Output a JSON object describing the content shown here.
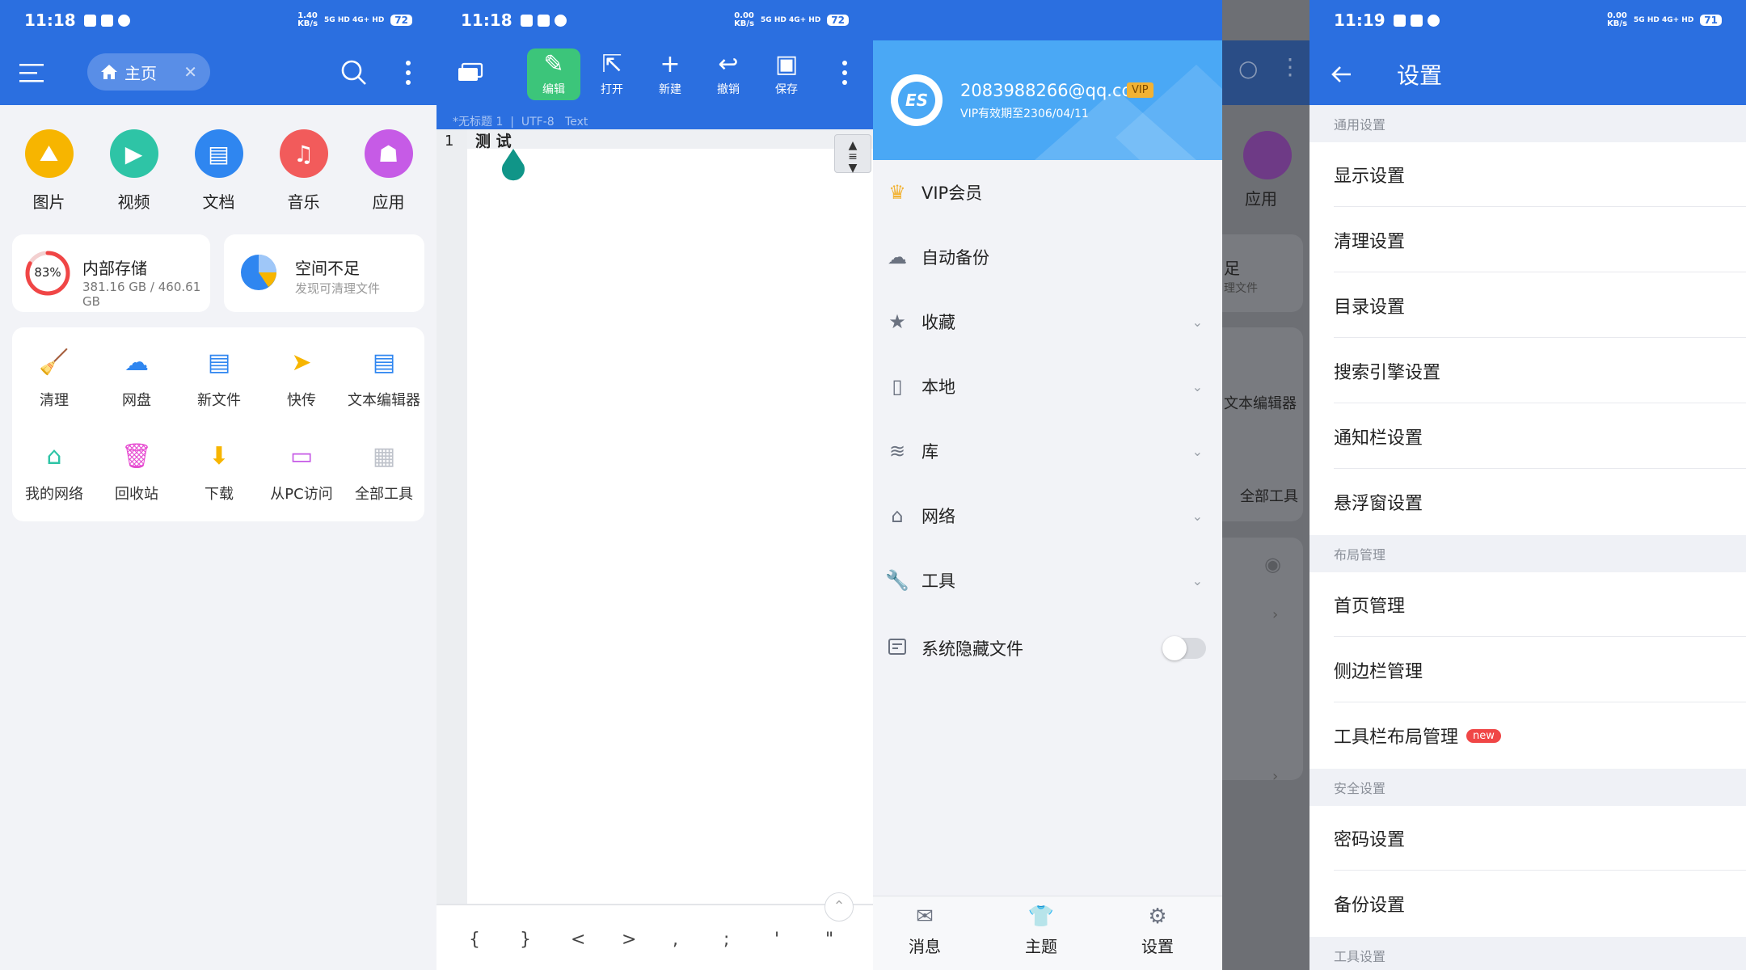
{
  "colors": {
    "primary": "#2b6fe0",
    "green": "#3cc57a",
    "red": "#f04646",
    "vip": "#f2b233"
  },
  "panel1": {
    "status": {
      "time": "11:18",
      "speed_top": "1.40",
      "speed_unit": "KB/s",
      "net": "5G HD 4G+ HD",
      "battery": "72"
    },
    "appbar": {
      "menu_icon": "menu-icon",
      "tab_label": "主页",
      "search_icon": "search-icon",
      "more_icon": "more-icon"
    },
    "categories": [
      {
        "label": "图片",
        "color": "#f7b500",
        "icon": "image-icon"
      },
      {
        "label": "视频",
        "color": "#2ec4a6",
        "icon": "video-icon"
      },
      {
        "label": "文档",
        "color": "#2f86f0",
        "icon": "document-icon"
      },
      {
        "label": "音乐",
        "color": "#f25b5b",
        "icon": "music-icon"
      },
      {
        "label": "应用",
        "color": "#c65be6",
        "icon": "android-icon"
      }
    ],
    "storage": {
      "percent_label": "83%",
      "percent": 83,
      "title": "内部存储",
      "detail": "381.16 GB / 460.61 GB"
    },
    "space": {
      "title": "空间不足",
      "subtitle": "发现可清理文件"
    },
    "tools_row1": [
      {
        "label": "清理",
        "icon": "broom-icon",
        "color": "#2ec4a6"
      },
      {
        "label": "网盘",
        "icon": "cloud-icon",
        "color": "#2f86f0"
      },
      {
        "label": "新文件",
        "icon": "new-file-icon",
        "color": "#2f86f0"
      },
      {
        "label": "快传",
        "icon": "send-icon",
        "color": "#f7b500"
      },
      {
        "label": "文本编辑器",
        "icon": "text-editor-icon",
        "color": "#2f86f0"
      }
    ],
    "tools_row2": [
      {
        "label": "我的网络",
        "icon": "router-icon",
        "color": "#2ec4a6"
      },
      {
        "label": "回收站",
        "icon": "trash-icon",
        "color": "#e64bd1"
      },
      {
        "label": "下载",
        "icon": "download-icon",
        "color": "#f7b500"
      },
      {
        "label": "从PC访问",
        "icon": "pc-icon",
        "color": "#c65be6"
      },
      {
        "label": "全部工具",
        "icon": "grid-icon",
        "color": "#bfc3cb"
      }
    ]
  },
  "panel2": {
    "status": {
      "time": "11:18",
      "speed_top": "0.00",
      "speed_unit": "KB/s",
      "net": "5G HD 4G+ HD",
      "battery": "72"
    },
    "toolbar": [
      {
        "label": "编辑",
        "icon": "edit-icon",
        "active": true
      },
      {
        "label": "打开",
        "icon": "open-icon"
      },
      {
        "label": "新建",
        "icon": "plus-icon"
      },
      {
        "label": "撤销",
        "icon": "undo-icon"
      },
      {
        "label": "保存",
        "icon": "save-icon"
      }
    ],
    "fileinfo": "*无标题 1  |  UTF-8   Text",
    "line_number": "1",
    "content": "测 试",
    "symbols": [
      "{",
      "}",
      "<",
      ">",
      ",",
      ";",
      "'",
      "\""
    ]
  },
  "panel3": {
    "status": {
      "time": "11:19",
      "speed_top": "0.00",
      "speed_unit": "KB/s",
      "net": "5G HD 4G+ HD",
      "battery": "71"
    },
    "account": {
      "email": "2083988266@qq.com",
      "vip_badge": "VIP",
      "expiry": "VIP有效期至2306/04/11"
    },
    "menu": [
      {
        "label": "VIP会员",
        "icon": "crown-icon",
        "chev": false
      },
      {
        "label": "自动备份",
        "icon": "cloud-backup-icon",
        "chev": false
      },
      {
        "label": "收藏",
        "icon": "star-icon",
        "chev": true
      },
      {
        "label": "本地",
        "icon": "phone-icon",
        "chev": true
      },
      {
        "label": "库",
        "icon": "layers-icon",
        "chev": true
      },
      {
        "label": "网络",
        "icon": "network-icon",
        "chev": true
      },
      {
        "label": "工具",
        "icon": "wrench-icon",
        "chev": true
      }
    ],
    "hidden_files": {
      "label": "系统隐藏文件",
      "on": false
    },
    "bottom": [
      {
        "label": "消息",
        "icon": "mail-icon"
      },
      {
        "label": "主题",
        "icon": "shirt-icon"
      },
      {
        "label": "设置",
        "icon": "gear-icon"
      }
    ],
    "bg": {
      "app_label": "应用",
      "full_label": "足",
      "sub_label": "理文件",
      "editor_label": "文本编辑器",
      "alltools_label": "全部工具"
    }
  },
  "panel4": {
    "status": {
      "time": "11:19",
      "speed_top": "0.00",
      "speed_unit": "KB/s",
      "net": "5G HD 4G+ HD",
      "battery": "71"
    },
    "title": "设置",
    "sections": [
      {
        "head": "通用设置",
        "items": [
          "显示设置",
          "清理设置",
          "目录设置",
          "搜索引擎设置",
          "通知栏设置",
          "悬浮窗设置"
        ]
      },
      {
        "head": "布局管理",
        "items": [
          "首页管理",
          "侧边栏管理",
          "工具栏布局管理"
        ]
      },
      {
        "head": "安全设置",
        "items": [
          "密码设置",
          "备份设置"
        ]
      },
      {
        "head": "工具设置",
        "items": []
      }
    ],
    "new_badge": "new"
  }
}
